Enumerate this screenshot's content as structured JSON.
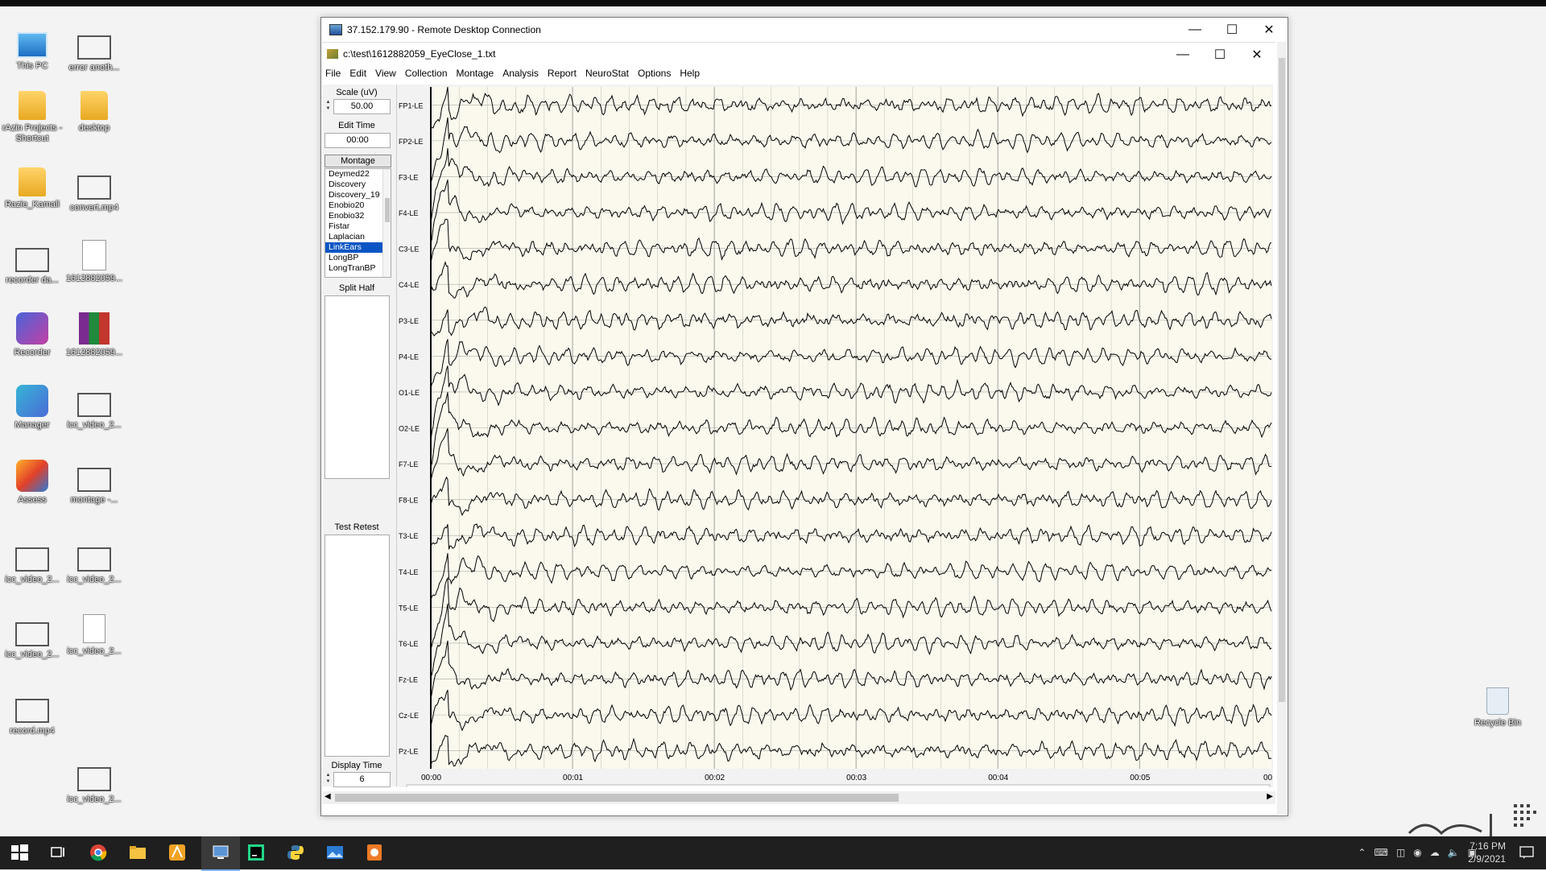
{
  "desktop_icons": [
    {
      "label": "This PC",
      "icon": "pc-icon"
    },
    {
      "label": "error anoth...",
      "icon": "film-icon"
    },
    {
      "label": "rAzin Projects - Shortcut",
      "icon": "folder-icon"
    },
    {
      "label": "desktop",
      "icon": "folder-icon"
    },
    {
      "label": "Razie_Kamali",
      "icon": "folder-icon"
    },
    {
      "label": "convert.mp4",
      "icon": "film-icon"
    },
    {
      "label": "recorder da...",
      "icon": "film-icon"
    },
    {
      "label": "1612882059...",
      "icon": "file-icon"
    },
    {
      "label": "Recorder",
      "icon": "recorder-app-icon"
    },
    {
      "label": "1612882059...",
      "icon": "winrar-icon"
    },
    {
      "label": "Manager",
      "icon": "manager-app-icon"
    },
    {
      "label": "icc_video_2...",
      "icon": "film-icon"
    },
    {
      "label": "Assess",
      "icon": "assess-app-icon"
    },
    {
      "label": "montage -...",
      "icon": "film-icon"
    },
    {
      "label": "icc_video_2...",
      "icon": "film-icon"
    },
    {
      "label": "icc_video_2...",
      "icon": "film-icon"
    },
    {
      "label": "icc_video_2...",
      "icon": "film-icon"
    },
    {
      "label": "icc_video_2...",
      "icon": "video-file-icon"
    },
    {
      "label": "record.mp4",
      "icon": "film-icon"
    },
    {
      "label": "icc_video_2...",
      "icon": "film-icon"
    },
    {
      "label": "Recycle Bin",
      "icon": "recycle-bin-icon"
    }
  ],
  "rdp_window": {
    "title": "37.152.179.90 - Remote Desktop Connection"
  },
  "app_window": {
    "title": "c:\\test\\1612882059_EyeClose_1.txt",
    "menu": [
      "File",
      "Edit",
      "View",
      "Collection",
      "Montage",
      "Analysis",
      "Report",
      "NeuroStat",
      "Options",
      "Help"
    ]
  },
  "left_panel": {
    "scale_label": "Scale (uV)",
    "scale_value": "50.00",
    "edit_time_label": "Edit Time",
    "edit_time_value": "00:00",
    "montage_button": "Montage",
    "montage_items": [
      "Deymed22",
      "Discovery",
      "Discovery_19",
      "Enobio20",
      "Enobio32",
      "Fistar",
      "Laplacian",
      "LinkEars",
      "LongBP",
      "LongTranBP"
    ],
    "montage_selected": "LinkEars",
    "split_half_label": "Split Half",
    "test_retest_label": "Test Retest",
    "display_time_label": "Display Time",
    "display_time_value": "6"
  },
  "eeg": {
    "channels": [
      "FP1-LE",
      "FP2-LE",
      "F3-LE",
      "F4-LE",
      "C3-LE",
      "C4-LE",
      "P3-LE",
      "P4-LE",
      "O1-LE",
      "O2-LE",
      "F7-LE",
      "F8-LE",
      "T3-LE",
      "T4-LE",
      "T5-LE",
      "T6-LE",
      "Fz-LE",
      "Cz-LE",
      "Pz-LE"
    ],
    "time_labels": [
      "00:00",
      "00:01",
      "00:02",
      "00:03",
      "00:04",
      "00:05",
      "00:"
    ],
    "background": "#fbf9ee",
    "gridline_color": "#8c8c8c",
    "trace_color": "#000000"
  },
  "taskbar": {
    "time": "7:16 PM",
    "date": "2/9/2021"
  }
}
